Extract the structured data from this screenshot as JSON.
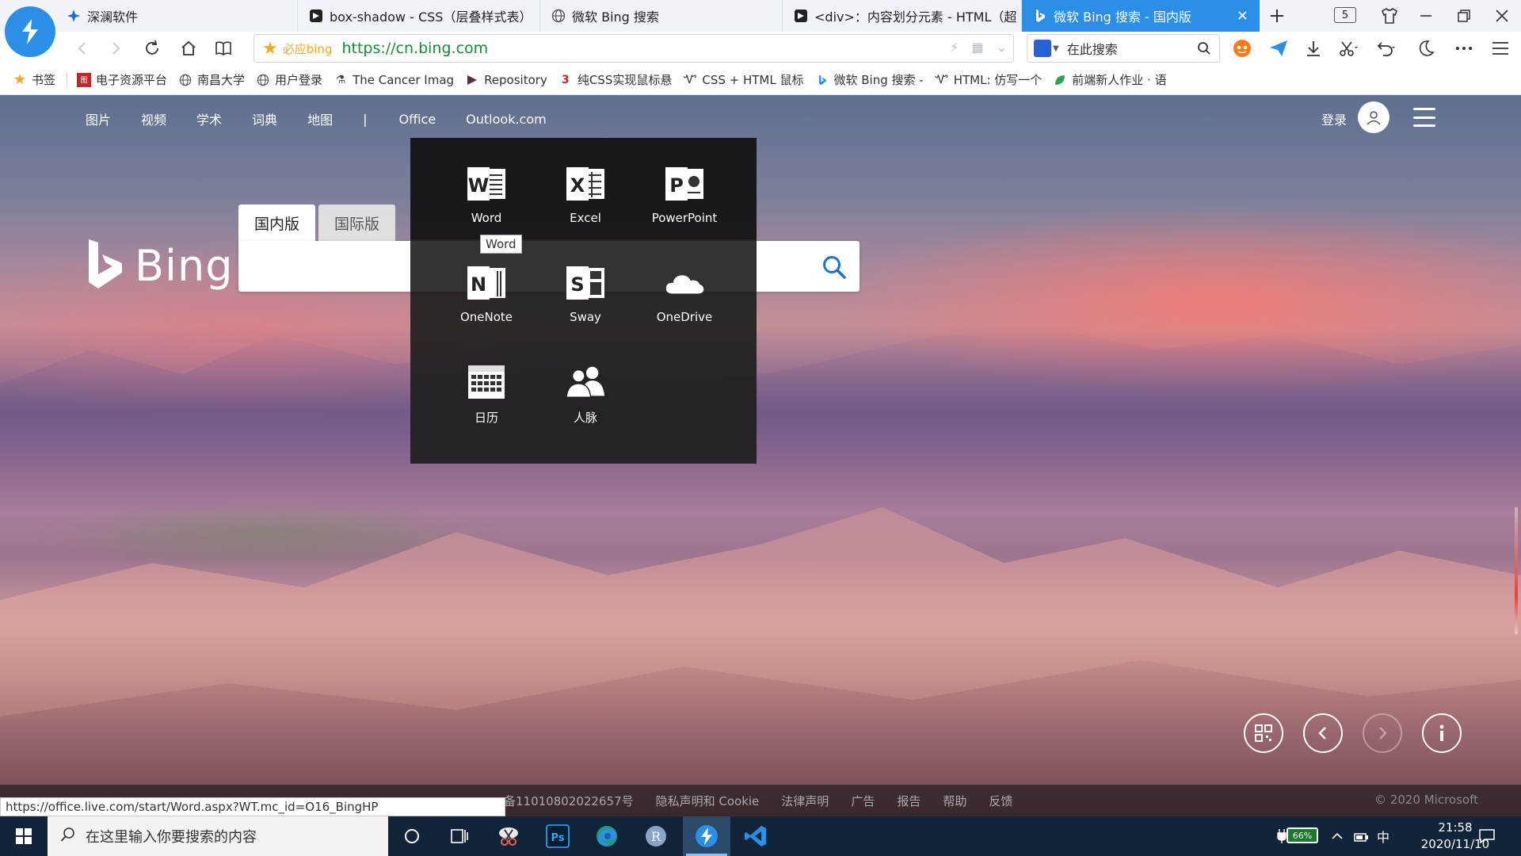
{
  "browser": {
    "tabs": [
      {
        "label": "深澜软件",
        "active": false
      },
      {
        "label": "box-shadow - CSS（层叠样式表）",
        "active": false
      },
      {
        "label": "微软 Bing 搜索",
        "active": false
      },
      {
        "label": "<div>：内容划分元素 - HTML（超",
        "active": false
      },
      {
        "label": "微软 Bing 搜索 - 国内版",
        "active": true
      }
    ],
    "tab_count": "5",
    "address": {
      "site_name": "必应bing",
      "url": "https://cn.bing.com"
    },
    "search_placeholder": "在此搜索",
    "bookmarks": [
      {
        "label": "书签",
        "icon": "star-icon"
      },
      {
        "label": "电子资源平台",
        "icon": "library-icon"
      },
      {
        "label": "南昌大学",
        "icon": "globe-icon"
      },
      {
        "label": "用户登录",
        "icon": "globe-icon"
      },
      {
        "label": "The Cancer Imag",
        "icon": "cancer-icon"
      },
      {
        "label": "Repository",
        "icon": "repo-icon"
      },
      {
        "label": "纯CSS实现鼠标悬",
        "icon": "css-icon"
      },
      {
        "label": "CSS + HTML 鼠标",
        "icon": "w3-icon"
      },
      {
        "label": "微软 Bing 搜索 -",
        "icon": "bing-icon"
      },
      {
        "label": "HTML: 仿写一个",
        "icon": "w3-icon"
      },
      {
        "label": "前端新人作业 · 语",
        "icon": "leaf-icon"
      }
    ],
    "status_url": "https://office.live.com/start/Word.aspx?WT.mc_id=O16_BingHP"
  },
  "bing": {
    "nav": [
      "图片",
      "视频",
      "学术",
      "词典",
      "地图",
      "|",
      "Office",
      "Outlook.com"
    ],
    "signin": "登录",
    "logo_text": "Bing",
    "search_tabs": [
      {
        "label": "国内版",
        "active": true
      },
      {
        "label": "国际版",
        "active": false
      }
    ],
    "office_apps": [
      {
        "label": "Word",
        "letter": "W"
      },
      {
        "label": "Excel",
        "letter": "X"
      },
      {
        "label": "PowerPoint",
        "letter": "P"
      },
      {
        "label": "OneNote",
        "letter": "N"
      },
      {
        "label": "Sway",
        "letter": "S"
      },
      {
        "label": "OneDrive",
        "letter": ""
      },
      {
        "label": "日历",
        "letter": ""
      },
      {
        "label": "人脉",
        "letter": ""
      }
    ],
    "tooltip": "Word",
    "footer_links": [
      "备11010802022657号",
      "隐私声明和 Cookie",
      "法律声明",
      "广告",
      "报告",
      "帮助",
      "反馈"
    ],
    "copyright": "© 2020 Microsoft"
  },
  "taskbar": {
    "search_placeholder": "在这里输入你要搜索的内容",
    "battery": "66%",
    "ime": "中",
    "time": "21:58",
    "date": "2020/11/10"
  },
  "colors": {
    "accent": "#2b8fe8",
    "taskbar": "#12243a",
    "url_green": "#1a8a3a",
    "bookmark_star": "#f5a623"
  }
}
